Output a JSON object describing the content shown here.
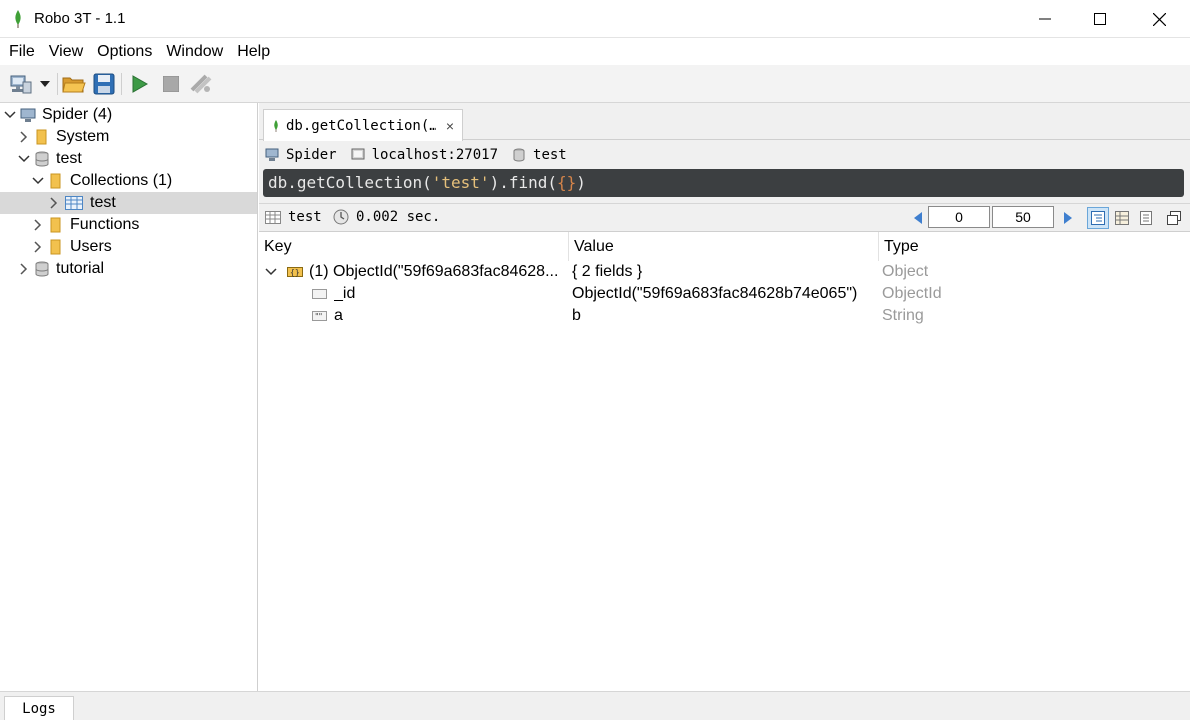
{
  "window": {
    "title": "Robo 3T - 1.1",
    "icon": "mongodb-leaf-icon"
  },
  "menu": {
    "items": [
      "File",
      "View",
      "Options",
      "Window",
      "Help"
    ]
  },
  "toolbar": {
    "buttons": [
      "connect-icon",
      "dropdown-arrow-icon",
      "open-folder-icon",
      "save-icon",
      "execute-play-icon",
      "stop-icon",
      "explain-icon"
    ]
  },
  "tree": {
    "items": [
      {
        "label": "Spider (4)",
        "icon": "server-icon",
        "expanded": true
      },
      {
        "label": "System",
        "icon": "folder-icon",
        "expanded": false
      },
      {
        "label": "test",
        "icon": "database-icon",
        "expanded": true
      },
      {
        "label": "Collections (1)",
        "icon": "folder-icon",
        "expanded": true
      },
      {
        "label": "test",
        "icon": "collection-table-icon",
        "expanded": false,
        "selected": true
      },
      {
        "label": "Functions",
        "icon": "folder-icon",
        "expanded": false
      },
      {
        "label": "Users",
        "icon": "folder-icon",
        "expanded": false
      },
      {
        "label": "tutorial",
        "icon": "database-icon",
        "expanded": false
      }
    ]
  },
  "tab": {
    "label": "db.getCollection(…",
    "close": "×"
  },
  "info": {
    "server": "Spider",
    "host": "localhost:27017",
    "database": "test"
  },
  "query": {
    "prefix": "db.getCollection(",
    "arg": "'test'",
    "mid": ").find(",
    "braces": "{}",
    "suffix": ")"
  },
  "result_bar": {
    "collection": "test",
    "time": "0.002 sec.",
    "skip": "0",
    "limit": "50"
  },
  "results": {
    "columns": [
      "Key",
      "Value",
      "Type"
    ],
    "rows": [
      {
        "key": "(1) ObjectId(\"59f69a683fac84628...",
        "value": "{ 2 fields }",
        "type": "Object",
        "level": 0,
        "icon": "object-icon"
      },
      {
        "key": "_id",
        "value": "ObjectId(\"59f69a683fac84628b74e065\")",
        "type": "ObjectId",
        "level": 1,
        "icon": "objectid-icon"
      },
      {
        "key": "a",
        "value": "b",
        "type": "String",
        "level": 1,
        "icon": "string-icon"
      }
    ]
  },
  "bottom": {
    "logs_label": "Logs"
  },
  "colors": {
    "query_bg": "#3c3f41",
    "query_string": "#e6c07b",
    "selected_row": "#d9d9d9",
    "type_text": "#9a9a9a"
  }
}
